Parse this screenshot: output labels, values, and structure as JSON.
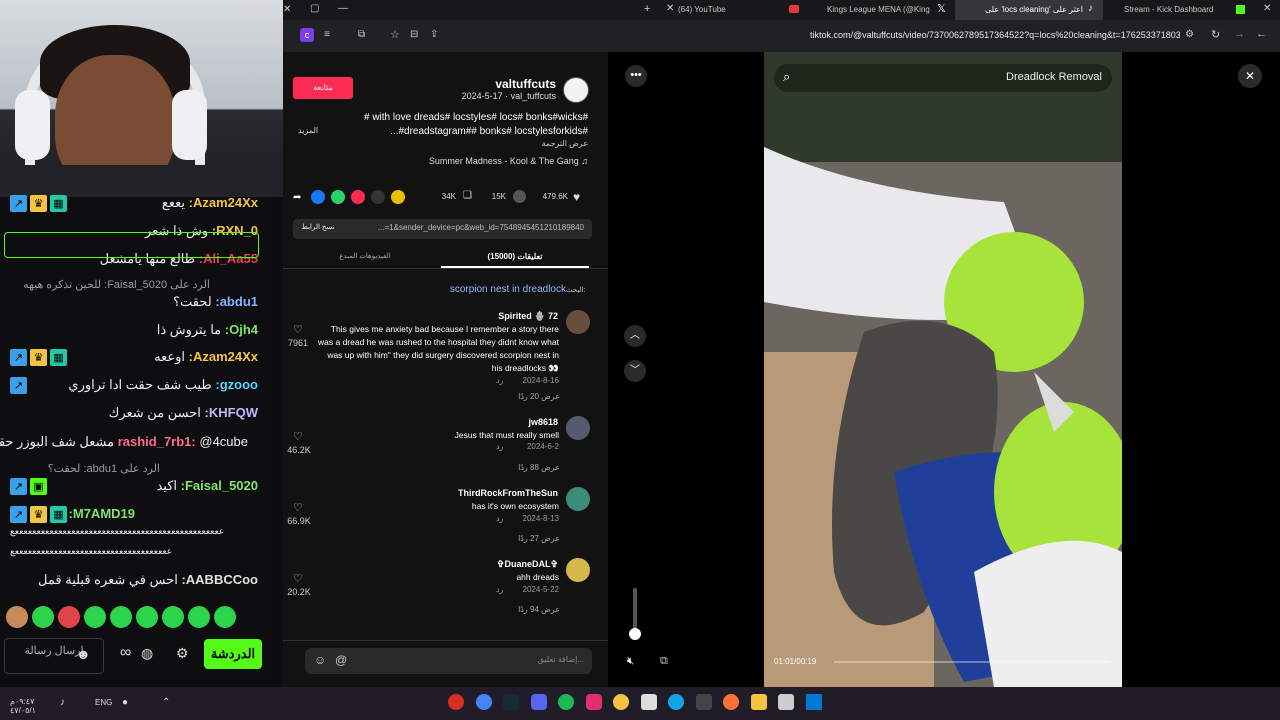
{
  "browser": {
    "tabs": [
      "(64) YouTube",
      "Kings League MENA (@KingsL...",
      "اعثر على 'locs cleaning' على",
      "Stream - Kick Dashboard"
    ],
    "url": "tiktok.com/@valtuffcuts/video/7370062789517364522?q=locs%20cleaning&t=1762533718031"
  },
  "post": {
    "username": "valtuffcuts",
    "date_handle": "2024-5-17 · val_tuffcuts",
    "follow_label": "متابعة",
    "more_label": "المزيد",
    "caption_line1": "# with love dreads# locstyles# locs# bonks#wicks#",
    "caption_line2": "...#dreadstagram## bonks# locstylesforkids#",
    "translate": "عرض الترجمة",
    "music": "Summer Madness - Kool & The Gang ♫",
    "likes": "479.6K",
    "comments": "15K",
    "saves": "34K",
    "copy_link_label": "نسخ الرابط",
    "share_link": "...=1&sender_device=pc&web_id=7548945451210189840",
    "tab_comments": "(15000) تعليقات",
    "tab_creator": "الفيديوهات المبدع",
    "search_hint_prefix": "البحث:",
    "search_hint": "scorpion nest in dreadlock",
    "comment_placeholder": "إضافة تعليق..."
  },
  "comments": [
    {
      "user": "Spirited 🪬 72",
      "text": "This gives me anxiety bad because I remember a story there was a dread he was rushed to the hospital they didnt know what was up with him\" they did surgery discovered scorpion nest in his dreadlocks 👀",
      "date": "2024-8-16",
      "reply": "رد",
      "likes": "7961",
      "view_replies": "عرض 20 ردًا"
    },
    {
      "user": "jw8618",
      "text": "Jesus that must really smell",
      "date": "2024-6-2",
      "reply": "رد",
      "likes": "46.2K",
      "view_replies": "عرض 88 ردًا"
    },
    {
      "user": "ThirdRockFromTheSun",
      "text": "has it's own ecosystem",
      "date": "2024-8-13",
      "reply": "رد",
      "likes": "66.9K",
      "view_replies": "عرض 27 ردًا"
    },
    {
      "user": "✞DuaneDAL✞",
      "text": "ahh dreads",
      "date": "2024-5-22",
      "reply": "رد",
      "likes": "20.2K",
      "view_replies": "عرض 94 ردًا"
    }
  ],
  "video": {
    "search_text": "Dreadlock Removal",
    "time": "01:01/00:19"
  },
  "chat": {
    "messages": [
      {
        "user": "Azam24Xx:",
        "text": "يععع",
        "color": "#f5c542"
      },
      {
        "user": "RXN_0:",
        "text": "وش ذا شعر",
        "color": "#f5c542"
      },
      {
        "user": "Ali_Aa55:",
        "text": "طالع منها يامشعل",
        "color": "#e0434a"
      },
      {
        "user": "abdu1:",
        "text": "لحقت؟",
        "color": "#7fb7ff"
      },
      {
        "user": "Ojh4:",
        "text": "ما يتروش ذا",
        "color": "#7ee46d"
      },
      {
        "user": "Azam24Xx:",
        "text": "اوععه",
        "color": "#f5c542"
      },
      {
        "user": "gzooo:",
        "text": "طيب شف حقت ادا تراوري",
        "color": "#5fd0ff"
      },
      {
        "user": "KHFQW:",
        "text": "احسن من شعرك",
        "color": "#c8b3ff"
      },
      {
        "user": "rashid_7rb1:",
        "text": "@4cube مشعل شف البوزر حقي",
        "color": "#ff6b8b"
      },
      {
        "user": "Faisal_5020:",
        "text": "اكيد",
        "color": "#7ee46d"
      },
      {
        "user": "M7AMD19:",
        "text": "",
        "color": "#7ee46d"
      },
      {
        "user": "AABBCCoo:",
        "text": "احس في شعره قبلية قمل",
        "color": "#e0e0e0"
      }
    ],
    "reply_1": "الرد على Faisal_5020: للحين تذكره هيهه",
    "reply_2": "الرد على abdu1: لحقت؟",
    "long_line_1": "ععععععععععععععععععععععععععععععععععععععععععععععععع",
    "long_line_2": "ععععععععععععععععععععععععععععععععععععع",
    "send_placeholder": "ارسال رسالة",
    "chat_button": "الدردشة"
  },
  "taskbar": {
    "time": "٠٩:٤٧م",
    "date": "٤٧/٠٥/١",
    "lang": "ENG"
  },
  "colors": {
    "kick_green": "#53fc18",
    "tiktok_red": "#fe2c55",
    "link_blue": "#8fb8ff"
  }
}
